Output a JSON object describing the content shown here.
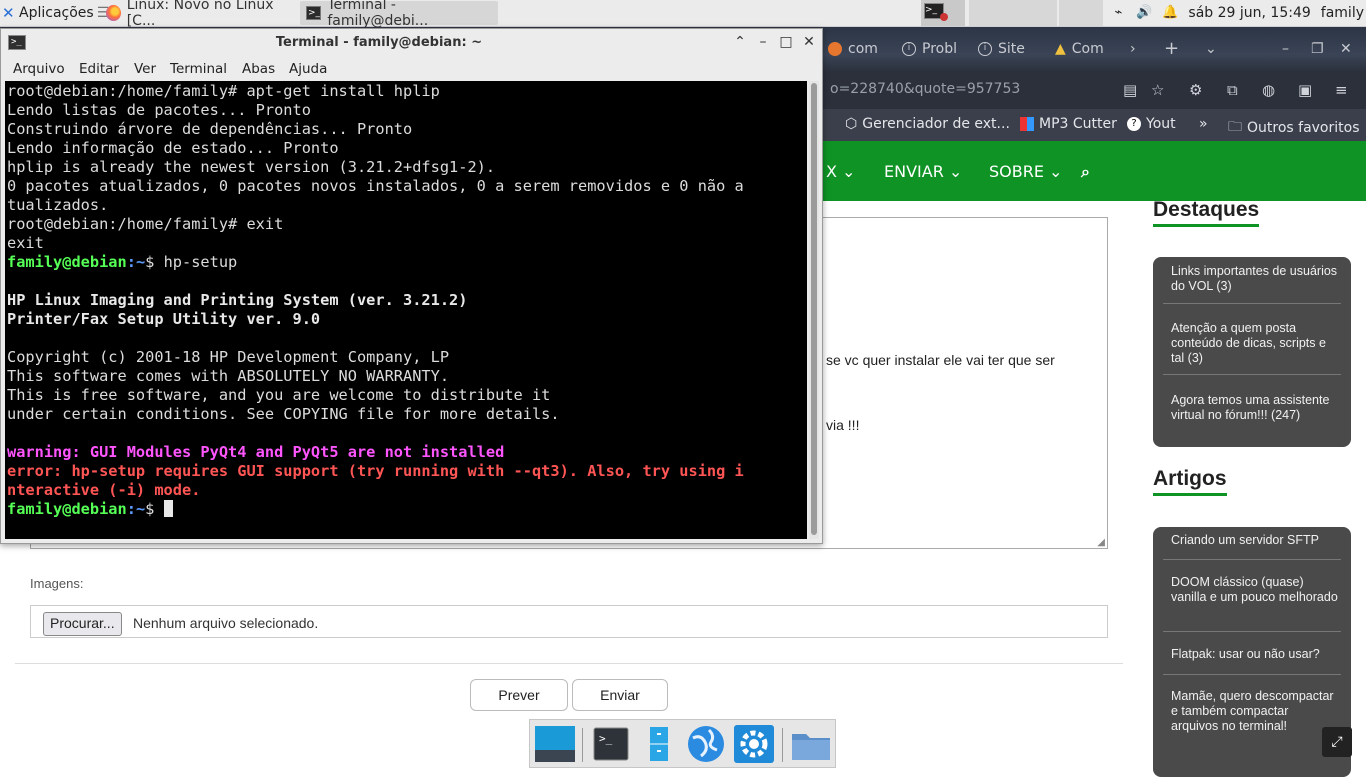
{
  "panel": {
    "apps_label": "Aplicações",
    "tasks": [
      "Linux: Novo no Linux [C...",
      "Terminal - family@debi..."
    ],
    "datetime": "sáb 29 jun, 15:49",
    "user": "family"
  },
  "browser": {
    "tabs": [
      "com",
      "Probl",
      "Site",
      "Com"
    ],
    "url": "o=228740&quote=957753",
    "bookmarks": [
      "Gerenciador de ext...",
      "MP3 Cutter",
      "Yout",
      "Outros favoritos"
    ],
    "nav": [
      "X",
      "ENVIAR",
      "SOBRE"
    ],
    "content_line1": "se vc quer instalar ele vai ter que ser",
    "content_line2": "via !!!",
    "images_label": "Imagens:",
    "file_button": "Procurar...",
    "file_status": "Nenhum arquivo selecionado.",
    "preview_button": "Prever",
    "send_button": "Enviar",
    "sidebar": {
      "destaques_title": "Destaques",
      "destaques": [
        "Links importantes de usuários do VOL (3)",
        "Atenção a quem posta conteúdo de dicas, scripts e tal (3)",
        "Agora temos uma assistente virtual no fórum!!! (247)"
      ],
      "artigos_title": "Artigos",
      "artigos": [
        "Criando um servidor SFTP",
        "DOOM clássico (quase) vanilla e um pouco melhorado",
        "Flatpak: usar ou não usar?",
        "Mamãe, quero descompactar e também compactar arquivos no terminal!"
      ]
    }
  },
  "terminal": {
    "title": "Terminal - family@debian: ~",
    "menu": [
      "Arquivo",
      "Editar",
      "Ver",
      "Terminal",
      "Abas",
      "Ajuda"
    ],
    "lines": [
      "root@debian:/home/family# apt-get install hplip",
      "Lendo listas de pacotes... Pronto",
      "Construindo árvore de dependências... Pronto",
      "Lendo informação de estado... Pronto",
      "hplip is already the newest version (3.21.2+dfsg1-2).",
      "0 pacotes atualizados, 0 pacotes novos instalados, 0 a serem removidos e 0 não a",
      "tualizados.",
      "root@debian:/home/family# exit",
      "exit"
    ],
    "prompt_user": "family@debian",
    "prompt_path": ":~",
    "prompt_symbol": "$ ",
    "cmd_hpsetup": "hp-setup",
    "hp_title": "HP Linux Imaging and Printing System (ver. 3.21.2)",
    "hp_subtitle": "Printer/Fax Setup Utility ver. 9.0",
    "copyright": [
      "Copyright (c) 2001-18 HP Development Company, LP",
      "This software comes with ABSOLUTELY NO WARRANTY.",
      "This is free software, and you are welcome to distribute it",
      "under certain conditions. See COPYING file for more details."
    ],
    "warning": "warning: GUI Modules PyQt4 and PyQt5 are not installed",
    "error": [
      "error: hp-setup requires GUI support (try running with --qt3). Also, try using i",
      "nteractive (-i) mode."
    ]
  }
}
